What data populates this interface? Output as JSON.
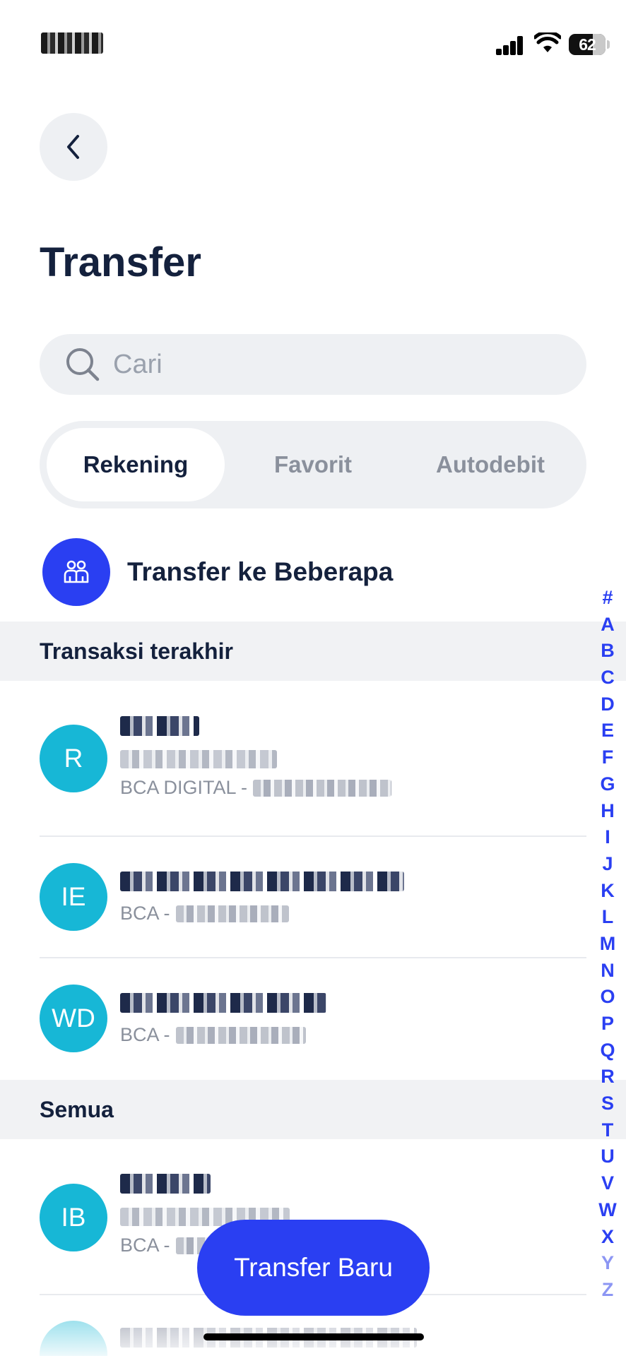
{
  "header": {
    "title": "Transfer",
    "back_icon": "chevron-left-icon"
  },
  "status_bar": {
    "battery": "62"
  },
  "search": {
    "placeholder": "Cari",
    "value": ""
  },
  "tabs": [
    {
      "label": "Rekening",
      "active": true
    },
    {
      "label": "Favorit",
      "active": false
    },
    {
      "label": "Autodebit",
      "active": false
    }
  ],
  "multi_transfer": {
    "label": "Transfer ke Beberapa",
    "icon": "group-people-icon"
  },
  "recent": {
    "title": "Transaksi terakhir",
    "items": [
      {
        "initials": "R",
        "bank": "BCA DIGITAL -"
      },
      {
        "initials": "IE",
        "bank": "BCA -"
      },
      {
        "initials": "WD",
        "bank": "BCA -"
      }
    ]
  },
  "all": {
    "title": "Semua",
    "items": [
      {
        "initials": "IB",
        "bank": "BCA -"
      }
    ]
  },
  "alphabet_index": [
    "#",
    "A",
    "B",
    "C",
    "D",
    "E",
    "F",
    "G",
    "H",
    "I",
    "J",
    "K",
    "L",
    "M",
    "N",
    "O",
    "P",
    "Q",
    "R",
    "S",
    "T",
    "U",
    "V",
    "W",
    "X",
    "Y",
    "Z"
  ],
  "fab": {
    "label": "Transfer Baru"
  },
  "colors": {
    "accent": "#2a3ff2",
    "avatar": "#17b7d6",
    "title": "#14213d",
    "muted": "#8a909c"
  }
}
